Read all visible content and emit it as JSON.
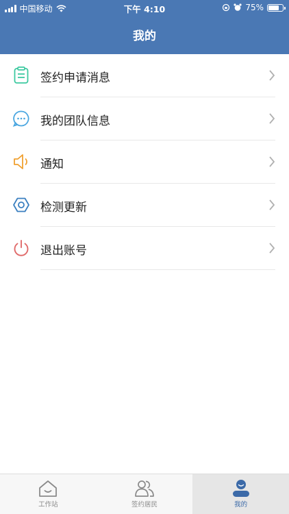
{
  "status_bar": {
    "carrier": "中国移动",
    "time": "下午 4:10",
    "battery": "75%"
  },
  "header": {
    "title": "我的"
  },
  "menu": {
    "items": [
      {
        "label": "签约申请消息",
        "icon": "clipboard-icon",
        "color": "#3cc9a0"
      },
      {
        "label": "我的团队信息",
        "icon": "chat-bubble-icon",
        "color": "#4aa6e0"
      },
      {
        "label": "通知",
        "icon": "speaker-icon",
        "color": "#f0a030"
      },
      {
        "label": "检测更新",
        "icon": "hexagon-settings-icon",
        "color": "#3a7fc0"
      },
      {
        "label": "退出账号",
        "icon": "power-icon",
        "color": "#e06a6a"
      }
    ]
  },
  "tabbar": {
    "tabs": [
      {
        "label": "工作站",
        "icon": "home-icon",
        "active": false
      },
      {
        "label": "签约居民",
        "icon": "people-icon",
        "active": false
      },
      {
        "label": "我的",
        "icon": "user-icon",
        "active": true
      }
    ]
  },
  "colors": {
    "header_bg": "#4a78b4",
    "tab_active": "#3c6aa8"
  }
}
